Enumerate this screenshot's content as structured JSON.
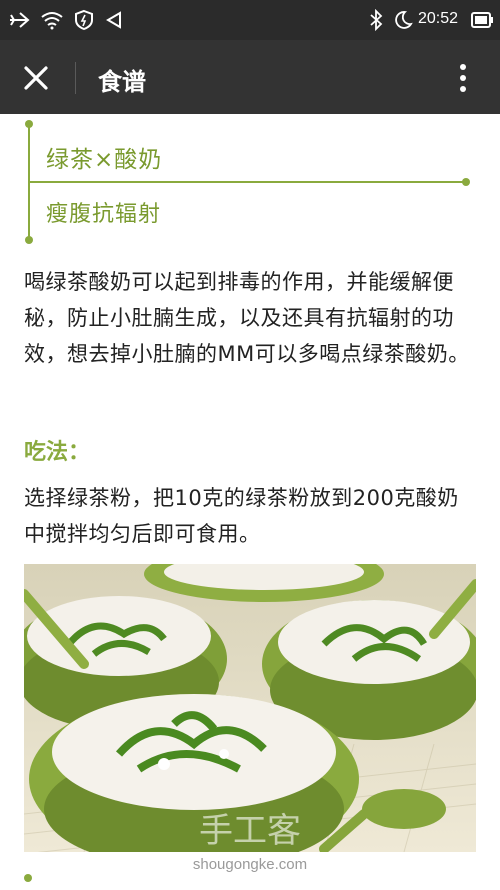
{
  "status_bar": {
    "time": "20:52",
    "icons": [
      "airplane-icon",
      "wifi-icon",
      "shield-icon",
      "volume-icon",
      "bluetooth-icon",
      "moon-icon",
      "battery-icon"
    ]
  },
  "title_bar": {
    "title": "食谱",
    "close_icon": "close-icon",
    "more_icon": "more-vertical-icon"
  },
  "article": {
    "heading": "绿茶×酸奶",
    "subheading": "瘦腹抗辐射",
    "paragraph1": "喝绿茶酸奶可以起到排毒的作用，并能缓解便秘，防止小肚腩生成，以及还具有抗辐射的功效，想去掉小肚腩的MM可以多喝点绿茶酸奶。",
    "method_label": "吃法：",
    "paragraph2": "选择绿茶粉，把10克的绿茶粉放到200克酸奶中搅拌均匀后即可食用。",
    "watermark_cn": "手工客",
    "watermark": "shougongke.com"
  },
  "colors": {
    "accent_green": "#8aaa3e",
    "title_bar": "#333333",
    "status_bar": "#2b2b2b"
  }
}
